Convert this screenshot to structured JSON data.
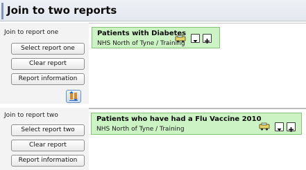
{
  "title": "Join to two reports",
  "sections": [
    {
      "label": "Join to report one",
      "buttons": {
        "select": "Select report one",
        "clear": "Clear report",
        "info": "Report information"
      },
      "report": {
        "title": "Patients with Diabetes",
        "subtitle": "NHS North of Tyne / Training"
      }
    },
    {
      "label": "Join to report two",
      "buttons": {
        "select": "Select report two",
        "clear": "Clear report",
        "info": "Report information"
      },
      "report": {
        "title": "Patients who have had a Flu Vaccine 2010",
        "subtitle": "NHS North of Tyne / Training"
      }
    }
  ],
  "icons": {
    "swap": "swap-reports-icon",
    "bus": "bus-icon",
    "dropdown": "dropdown-arrow-icon",
    "add": "plus-icon"
  },
  "colors": {
    "card_bg": "#ccf3c4",
    "card_border": "#86c07a",
    "panel_bg": "#f3f3f3"
  }
}
